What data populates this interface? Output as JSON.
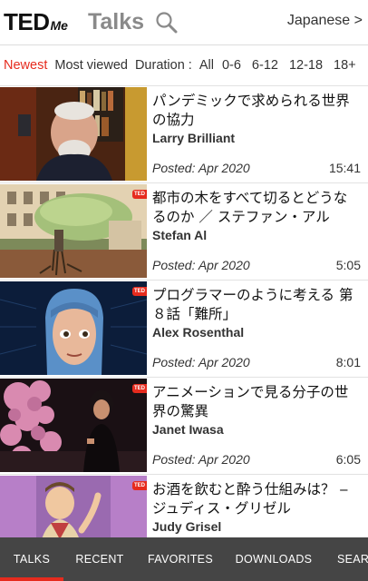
{
  "header": {
    "logo_main": "TED",
    "logo_sub": "Me",
    "title": "Talks",
    "language": "Japanese >"
  },
  "filters": {
    "newest": "Newest",
    "most_viewed": "Most viewed",
    "duration_label": "Duration :",
    "options": [
      "All",
      "0-6",
      "6-12",
      "12-18",
      "18+"
    ]
  },
  "talks": [
    {
      "title": "パンデミックで求められる世界の協力",
      "speaker": "Larry Brilliant",
      "posted": "Posted: Apr 2020",
      "duration": "15:41"
    },
    {
      "title": "都市の木をすべて切るとどうなるのか ／ ステファン・アル",
      "speaker": "Stefan Al",
      "posted": "Posted: Apr 2020",
      "duration": "5:05"
    },
    {
      "title": "プログラマーのように考える 第８話「難所」",
      "speaker": "Alex Rosenthal",
      "posted": "Posted: Apr 2020",
      "duration": "8:01"
    },
    {
      "title": "アニメーションで見る分子の世界の驚異",
      "speaker": "Janet Iwasa",
      "posted": "Posted: Apr 2020",
      "duration": "6:05"
    },
    {
      "title": "お酒を飲むと酔う仕組みは？ ‒ ジュディス・グリゼル",
      "speaker": "Judy Grisel",
      "posted": "",
      "duration": ""
    }
  ],
  "badge_label": "TED",
  "nav": {
    "tabs": [
      "TALKS",
      "RECENT",
      "FAVORITES",
      "DOWNLOADS",
      "SEARCH"
    ]
  },
  "colors": {
    "accent": "#e62b1e",
    "nav_bg": "#454545"
  }
}
